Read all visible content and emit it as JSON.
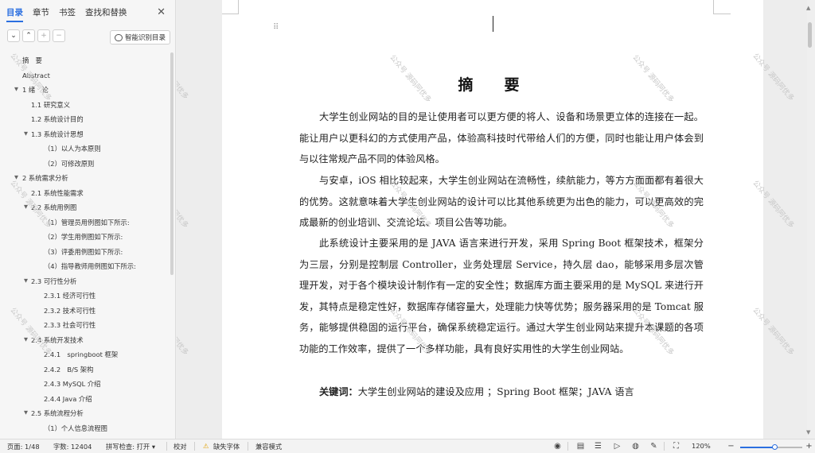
{
  "sidebar": {
    "tabs": [
      "目录",
      "章节",
      "书签",
      "查找和替换"
    ],
    "smart_button": "智能识别目录",
    "toc": [
      {
        "label": "摘　要",
        "level": 0,
        "caret": ""
      },
      {
        "label": "Abstract",
        "level": 0,
        "caret": ""
      },
      {
        "label": "1 绪　论",
        "level": 0,
        "caret": "▼"
      },
      {
        "label": "1.1 研究意义",
        "level": 1,
        "caret": ""
      },
      {
        "label": "1.2 系统设计目的",
        "level": 1,
        "caret": ""
      },
      {
        "label": "1.3 系统设计思想",
        "level": 1,
        "caret": "▼"
      },
      {
        "label": "（1）以人为本原则",
        "level": 2,
        "caret": ""
      },
      {
        "label": "（2）可修改原则",
        "level": 2,
        "caret": ""
      },
      {
        "label": "2 系统需求分析",
        "level": 0,
        "caret": "▼"
      },
      {
        "label": "2.1 系统性能需求",
        "level": 1,
        "caret": ""
      },
      {
        "label": "2.2 系统用例图",
        "level": 1,
        "caret": "▼"
      },
      {
        "label": "（1）管理员用例图如下所示:",
        "level": 2,
        "caret": ""
      },
      {
        "label": "（2）学生用例图如下所示:",
        "level": 2,
        "caret": ""
      },
      {
        "label": "（3）评委用例图如下所示:",
        "level": 2,
        "caret": ""
      },
      {
        "label": "（4）指导教师用例图如下所示:",
        "level": 2,
        "caret": ""
      },
      {
        "label": "2.3 可行性分析",
        "level": 1,
        "caret": "▼"
      },
      {
        "label": "2.3.1 经济可行性",
        "level": 2,
        "caret": ""
      },
      {
        "label": "2.3.2 技术可行性",
        "level": 2,
        "caret": ""
      },
      {
        "label": "2.3.3 社会可行性",
        "level": 2,
        "caret": ""
      },
      {
        "label": "2.4 系统开发技术",
        "level": 1,
        "caret": "▼"
      },
      {
        "label": "2.4.1　springboot 框架",
        "level": 2,
        "caret": ""
      },
      {
        "label": "2.4.2　B/S 架构",
        "level": 2,
        "caret": ""
      },
      {
        "label": "2.4.3 MySQL 介绍",
        "level": 2,
        "caret": ""
      },
      {
        "label": "2.4.4 Java 介绍",
        "level": 2,
        "caret": ""
      },
      {
        "label": "2.5 系统流程分析",
        "level": 1,
        "caret": "▼"
      },
      {
        "label": "（1）个人信息流程图",
        "level": 2,
        "caret": ""
      }
    ]
  },
  "document": {
    "title": "摘　要",
    "paragraphs": [
      "大学生创业网站的目的是让使用者可以更方便的将人、设备和场景更立体的连接在一起。能让用户以更科幻的方式使用产品，体验高科技时代带给人们的方便，同时也能让用户体会到与以往常规产品不同的体验风格。",
      "与安卓，iOS 相比较起来，大学生创业网站在流畅性，续航能力，等方方面面都有着很大的优势。这就意味着大学生创业网站的设计可以比其他系统更为出色的能力，可以更高效的完成最新的创业培训、交流论坛、项目公告等功能。",
      "此系统设计主要采用的是 JAVA 语言来进行开发，采用 Spring Boot 框架技术，框架分为三层，分别是控制层 Controller，业务处理层 Service，持久层 dao，能够采用多层次管理开发，对于各个模块设计制作有一定的安全性；数据库方面主要采用的是 MySQL 来进行开发，其特点是稳定性好，数据库存储容量大，处理能力快等优势；服务器采用的是 Tomcat 服务，能够提供稳固的运行平台，确保系统稳定运行。通过大学生创业网站来提升本课题的各项功能的工作效率，提供了一个多样功能，具有良好实用性的大学生创业网站。"
    ],
    "keywords_label": "关键词：",
    "keywords": "大学生创业网站的建设及应用 ；Spring Boot 框架；JAVA 语言",
    "watermark": "公众号 源码阿优多"
  },
  "status": {
    "page": "页面: 1/48",
    "words": "字数: 12404",
    "spell": "拼写检查: 打开 ▾",
    "proof": "校对",
    "missing_font": "缺失字体",
    "compat": "兼容模式",
    "zoom": "120%",
    "zoom_level": 0.55
  }
}
